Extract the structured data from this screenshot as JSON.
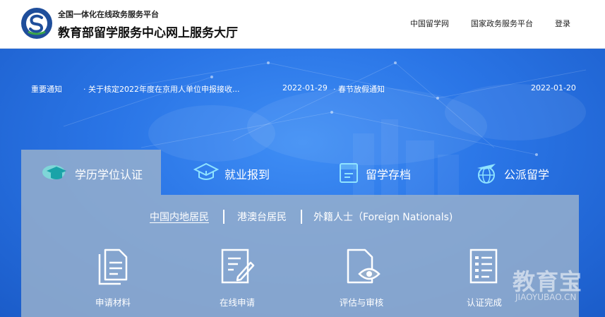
{
  "header": {
    "subtitle": "全国一体化在线政务服务平台",
    "title": "教育部留学服务中心网上服务大厅",
    "nav": [
      "中国留学网",
      "国家政务服务平台",
      "登录"
    ]
  },
  "notices": {
    "tag": "重要通知",
    "items": [
      {
        "text": "· 关于核定2022年度在京用人单位申报接收...",
        "date": "2022-01-29"
      },
      {
        "text": "· 春节放假通知",
        "date": "2022-01-20"
      }
    ]
  },
  "tabs": [
    {
      "label": "学历学位认证",
      "icon": "graduation-cap-cloud-icon"
    },
    {
      "label": "就业报到",
      "icon": "mortarboard-icon"
    },
    {
      "label": "留学存档",
      "icon": "archive-folder-icon"
    },
    {
      "label": "公派留学",
      "icon": "airplane-globe-icon"
    }
  ],
  "subtabs": [
    "中国内地居民",
    "港澳台居民",
    "外籍人士（Foreign Nationals)"
  ],
  "steps": [
    {
      "label": "申请材料",
      "icon": "documents-icon"
    },
    {
      "label": "在线申请",
      "icon": "edit-form-icon"
    },
    {
      "label": "评估与审核",
      "icon": "review-eye-icon"
    },
    {
      "label": "认证完成",
      "icon": "checklist-icon"
    }
  ],
  "watermark": {
    "cn": "教育宝",
    "en": "JIAOYUBAO.CN"
  },
  "colors": {
    "banner": "#2a75e6",
    "logo": "#1f4e9b",
    "panel": "#96afcd"
  }
}
